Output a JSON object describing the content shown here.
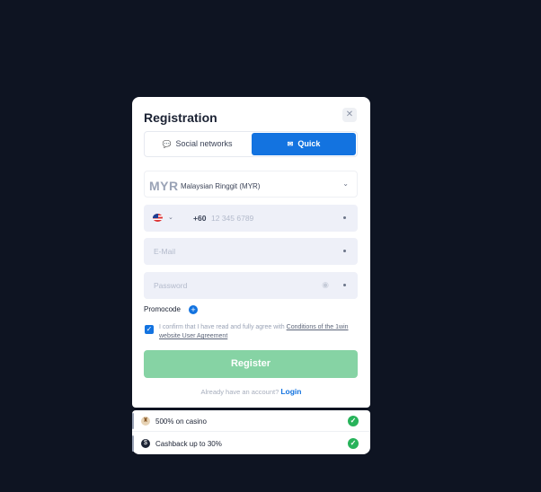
{
  "modal": {
    "title": "Registration",
    "close_icon": "close-icon"
  },
  "tabs": [
    {
      "label": "Social networks",
      "icon": "chat-icon",
      "active": false
    },
    {
      "label": "Quick",
      "icon": "envelope-icon",
      "active": true
    }
  ],
  "currency": {
    "code": "MYR",
    "name": "Malaysian Ringgit (MYR)"
  },
  "phone": {
    "country_code": "+60",
    "placeholder": "12 345 6789"
  },
  "email": {
    "placeholder": "E-Mail"
  },
  "password": {
    "placeholder": "Password"
  },
  "promocode": {
    "label": "Promocode"
  },
  "agreement": {
    "text": "I confirm that I have read and fully agree with ",
    "link": "Conditions of the 1win website User Agreement",
    "checked": true
  },
  "register_label": "Register",
  "login": {
    "prompt": "Already have an account?",
    "link": "Login"
  },
  "bonuses": [
    {
      "label": "500% on casino",
      "icon": "casino-icon"
    },
    {
      "label": "Cashback up to 30%",
      "icon": "cashback-icon"
    }
  ],
  "colors": {
    "accent": "#1373e0",
    "register": "#86d3a4",
    "success": "#27b35a",
    "background": "#0e1422"
  }
}
